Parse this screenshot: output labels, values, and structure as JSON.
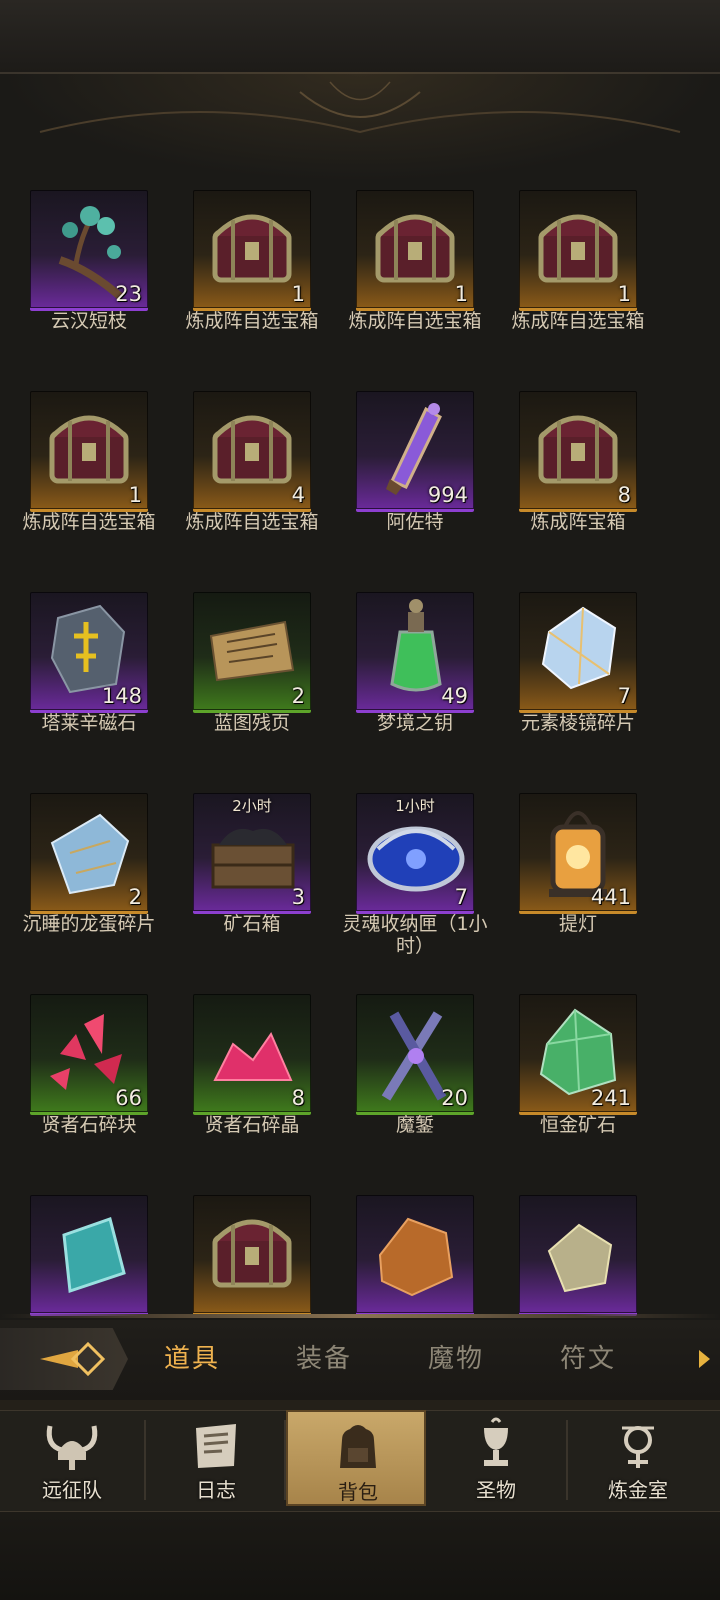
{
  "items": [
    {
      "name": "云汉短枝",
      "count": "23",
      "rarity": "purple",
      "icon": "branch-icon"
    },
    {
      "name": "炼成阵自选宝箱",
      "count": "1",
      "rarity": "gold",
      "icon": "chest-icon"
    },
    {
      "name": "炼成阵自选宝箱",
      "count": "1",
      "rarity": "gold",
      "icon": "chest-icon"
    },
    {
      "name": "炼成阵自选宝箱",
      "count": "1",
      "rarity": "gold",
      "icon": "chest-icon"
    },
    {
      "name": "炼成阵自选宝箱",
      "count": "1",
      "rarity": "gold",
      "icon": "chest-icon"
    },
    {
      "name": "炼成阵自选宝箱",
      "count": "4",
      "rarity": "gold",
      "icon": "chest-icon"
    },
    {
      "name": "阿佐特",
      "count": "994",
      "rarity": "purple",
      "icon": "vial-icon"
    },
    {
      "name": "炼成阵宝箱",
      "count": "8",
      "rarity": "gold",
      "icon": "chest-icon"
    },
    {
      "name": "塔莱辛磁石",
      "count": "148",
      "rarity": "purple",
      "icon": "runestone-icon"
    },
    {
      "name": "蓝图残页",
      "count": "2",
      "rarity": "green",
      "icon": "scroll-icon"
    },
    {
      "name": "梦境之钥",
      "count": "49",
      "rarity": "purple",
      "icon": "potion-icon"
    },
    {
      "name": "元素棱镜碎片",
      "count": "7",
      "rarity": "gold",
      "icon": "crystal-shard-icon"
    },
    {
      "name": "沉睡的龙蛋碎片",
      "count": "2",
      "rarity": "gold",
      "icon": "egg-shard-icon"
    },
    {
      "name": "矿石箱",
      "count": "3",
      "rarity": "purple",
      "icon": "ore-crate-icon",
      "timer": "2小时"
    },
    {
      "name": "灵魂收纳匣（1小时）",
      "count": "7",
      "rarity": "purple",
      "icon": "soul-casket-icon",
      "timer": "1小时"
    },
    {
      "name": "提灯",
      "count": "441",
      "rarity": "gold",
      "icon": "lantern-icon"
    },
    {
      "name": "贤者石碎块",
      "count": "66",
      "rarity": "green",
      "icon": "red-shards-icon"
    },
    {
      "name": "贤者石碎晶",
      "count": "8",
      "rarity": "green",
      "icon": "red-crystal-icon"
    },
    {
      "name": "魔錾",
      "count": "20",
      "rarity": "green",
      "icon": "chisel-icon"
    },
    {
      "name": "恒金矿石",
      "count": "241",
      "rarity": "gold",
      "icon": "green-ore-icon"
    },
    {
      "name": "",
      "count": "",
      "rarity": "purple",
      "icon": "teal-crystal-icon"
    },
    {
      "name": "",
      "count": "",
      "rarity": "gold",
      "icon": "chest-icon"
    },
    {
      "name": "",
      "count": "",
      "rarity": "purple",
      "icon": "amber-stone-icon"
    },
    {
      "name": "",
      "count": "",
      "rarity": "purple",
      "icon": "yellow-ore-icon"
    }
  ],
  "tabs": [
    {
      "label": "道具",
      "active": true
    },
    {
      "label": "装备",
      "active": false
    },
    {
      "label": "魔物",
      "active": false
    },
    {
      "label": "符文",
      "active": false
    }
  ],
  "nav": [
    {
      "label": "远征队",
      "icon": "viking-helmet-icon",
      "active": false
    },
    {
      "label": "日志",
      "icon": "journal-icon",
      "active": false
    },
    {
      "label": "背包",
      "icon": "backpack-icon",
      "active": true
    },
    {
      "label": "圣物",
      "icon": "chalice-icon",
      "active": false
    },
    {
      "label": "炼金室",
      "icon": "alchemy-icon",
      "active": false
    }
  ],
  "colors": {
    "purple": "#8d3fd0",
    "gold": "#c78a2a",
    "green": "#5ea52a",
    "active_tab": "#efb24f"
  }
}
